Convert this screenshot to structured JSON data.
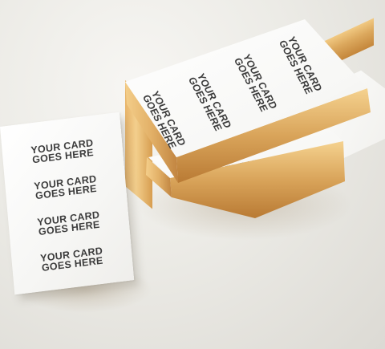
{
  "card_text": {
    "line1": "YOUR CARD",
    "line2": "GOES HERE"
  },
  "colors": {
    "background": "#e8e7e3",
    "card_white": "#ffffff",
    "gold_edge": "#d9a45a",
    "text": "#3c3c3c"
  },
  "flat_card_block_count": 4,
  "top_stack_block_count": 4,
  "lower_stack_visible_blocks": 1
}
